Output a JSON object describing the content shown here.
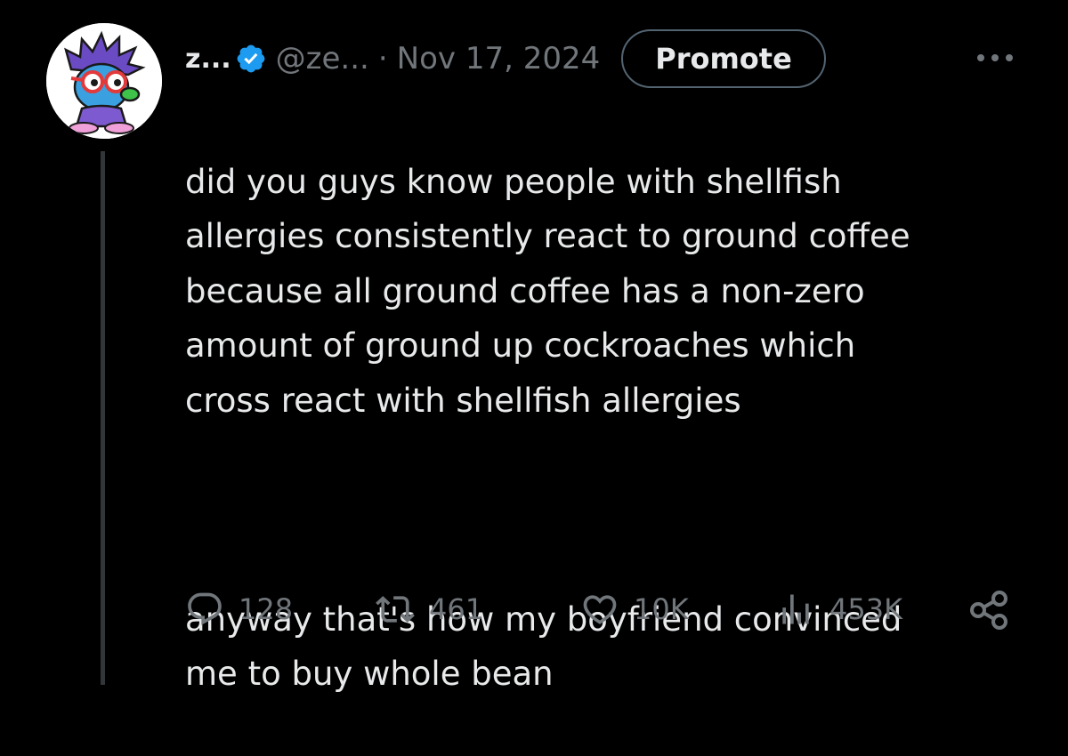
{
  "author": {
    "display_name": "z...",
    "handle": "@ze...",
    "separator": "·",
    "date": "Nov 17, 2024",
    "verified": true
  },
  "header": {
    "promote_label": "Promote",
    "more_icon": "more-horizontal-icon"
  },
  "tweet": {
    "paragraph_1": "did you guys know people with shellfish\nallergies consistently react to ground coffee\nbecause all ground coffee has a non-zero\namount of ground up cockroaches which\ncross react with shellfish allergies",
    "paragraph_2": "anyway that's how my boyfriend  convinced\nme to buy whole bean"
  },
  "actions": {
    "reply_count": "128",
    "retweet_count": "461",
    "like_count": "10K",
    "views_count": "453K"
  },
  "colors": {
    "background": "#000000",
    "text_primary": "#e7e9ea",
    "text_secondary": "#71767b",
    "verified_blue": "#1d9bf0",
    "border": "#536471"
  }
}
